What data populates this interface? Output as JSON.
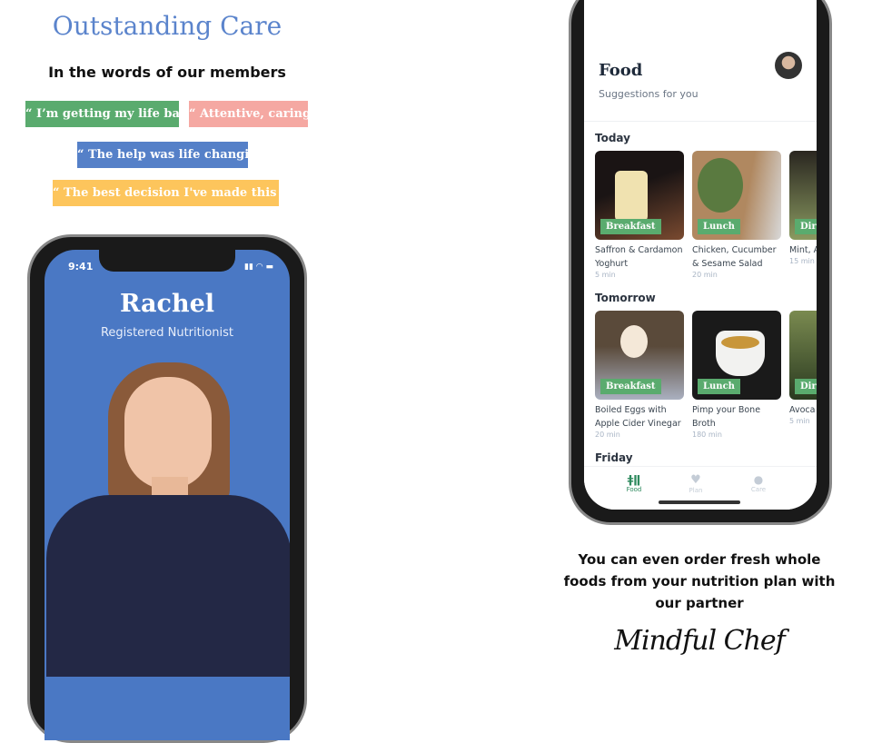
{
  "title": "Outstanding Care",
  "subtitle": "In the words of our members",
  "quotes": [
    {
      "text": "“ I’m getting my life back ”",
      "color": "#5aab6e"
    },
    {
      "text": "“ Attentive, caring ”",
      "color": "#f5a8a2"
    },
    {
      "text": "“ The help was life changing ”",
      "color": "#5580c8"
    },
    {
      "text": "“ The best decision I've made this year ”",
      "color": "#fdc55c"
    }
  ],
  "left_phone": {
    "time": "9:41",
    "name": "Rachel",
    "role": "Registered Nutritionist"
  },
  "right_phone": {
    "header": "Food",
    "subheader": "Suggestions for you",
    "sections": [
      {
        "label": "Today",
        "cards": [
          {
            "tag": "Breakfast",
            "title": "Saffron & Cardamon Yoghurt",
            "time": "5 min"
          },
          {
            "tag": "Lunch",
            "title": "Chicken, Cucumber & Sesame Salad",
            "time": "20 min"
          },
          {
            "tag": "Dir",
            "title": "Mint, Avoca",
            "time": "15 min"
          }
        ]
      },
      {
        "label": "Tomorrow",
        "cards": [
          {
            "tag": "Breakfast",
            "title": "Boiled Eggs with Apple Cider Vinegar",
            "time": "20 min"
          },
          {
            "tag": "Lunch",
            "title": "Pimp your Bone Broth",
            "time": "180 min"
          },
          {
            "tag": "Dir",
            "title": "Avoca",
            "time": "5 min"
          }
        ]
      },
      {
        "label": "Friday"
      }
    ],
    "nav": [
      {
        "label": "Food",
        "icon": "fork-knife-icon",
        "active": true
      },
      {
        "label": "Plan",
        "icon": "heart-icon"
      },
      {
        "label": "Care",
        "icon": "chat-icon"
      }
    ],
    "accent": "#2e8a5e"
  },
  "caption": "You can even order fresh whole foods from your nutrition plan with our partner",
  "partner_logo": "Mindful Chef"
}
